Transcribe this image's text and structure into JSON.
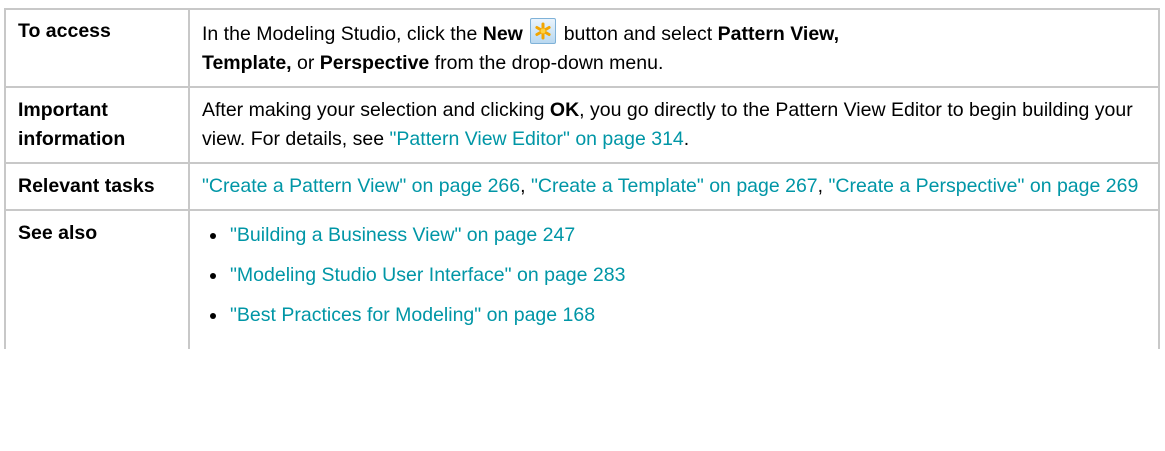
{
  "rows": {
    "access": {
      "label": "To access",
      "t1": "In the Modeling Studio, click the ",
      "b1": "New",
      "icon": "new-asterisk-icon",
      "t2": " button and select ",
      "b2": "Pattern View,",
      "t3": " ",
      "b3": "Template,",
      "t4": " or ",
      "b4": "Perspective",
      "t5": " from the drop-down menu."
    },
    "important": {
      "label": "Important information",
      "t1": "After making your selection and clicking ",
      "b1": "OK",
      "t2": ", you go directly to the Pattern View Editor to begin building your view. For details, see ",
      "link": "\"Pattern View Editor\" on page 314",
      "t3": "."
    },
    "tasks": {
      "label": "Relevant tasks",
      "link1": "\"Create a Pattern View\" on page 266",
      "sep1": ", ",
      "link2": "\"Create a Template\" on page 267",
      "sep2": ", ",
      "link3": "\"Create a Perspective\" on page 269"
    },
    "see_also": {
      "label": "See also",
      "items": [
        "\"Building a Business View\" on page 247",
        "\"Modeling Studio User Interface\" on page 283",
        "\"Best Practices for Modeling\" on page 168"
      ]
    }
  },
  "colors": {
    "link": "#0096a6",
    "border": "#c8c8c8"
  }
}
